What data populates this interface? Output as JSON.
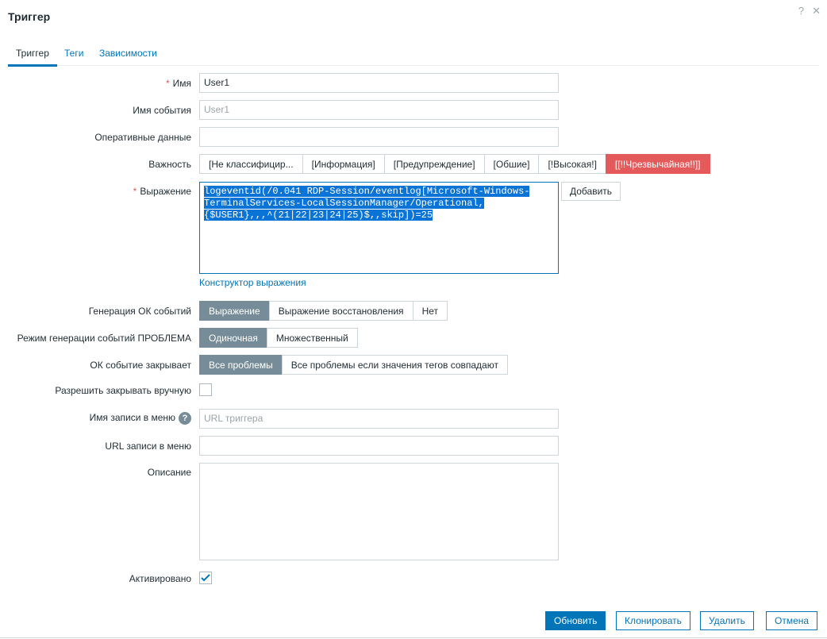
{
  "title": "Триггер",
  "tabs": [
    "Триггер",
    "Теги",
    "Зависимости"
  ],
  "form": {
    "name_label": "Имя",
    "name_value": "User1",
    "event_name_label": "Имя события",
    "event_name_placeholder": "User1",
    "opdata_label": "Оперативные данные",
    "severity_label": "Важность",
    "severities": [
      "[Не классифицир...",
      "[Информация]",
      "[Предупреждение]",
      "[Обшие]",
      "[!Высокая!]",
      "[[!!Чрезвычайная!!]]"
    ],
    "severity_selected": "[[!!Чрезвычайная!!]]",
    "expression_label": "Выражение",
    "expression_lines": [
      "logeventid(/0.041 RDP-Session/eventlog[Microsoft-Windows-",
      "TerminalServices-LocalSessionManager/Operational,",
      "{$USER1},,,^(21|22|23|24|25)$,,skip])=25"
    ],
    "add_button": "Добавить",
    "constructor_link": "Конструктор выражения",
    "ok_gen_label": "Генерация ОК событий",
    "ok_gen_options": [
      "Выражение",
      "Выражение восстановления",
      "Нет"
    ],
    "problem_mode_label": "Режим генерации событий ПРОБЛЕМА",
    "problem_mode_options": [
      "Одиночная",
      "Множественный"
    ],
    "ok_closes_label": "ОК событие закрывает",
    "ok_closes_options": [
      "Все проблемы",
      "Все проблемы если значения тегов совпадают"
    ],
    "manual_close_label": "Разрешить закрывать вручную",
    "manual_close_checked": false,
    "menu_name_label": "Имя записи в меню",
    "menu_name_placeholder": "URL триггера",
    "menu_url_label": "URL записи в меню",
    "description_label": "Описание",
    "enabled_label": "Активировано",
    "enabled_checked": true
  },
  "footer": {
    "update": "Обновить",
    "clone": "Клонировать",
    "delete": "Удалить",
    "cancel": "Отмена"
  }
}
